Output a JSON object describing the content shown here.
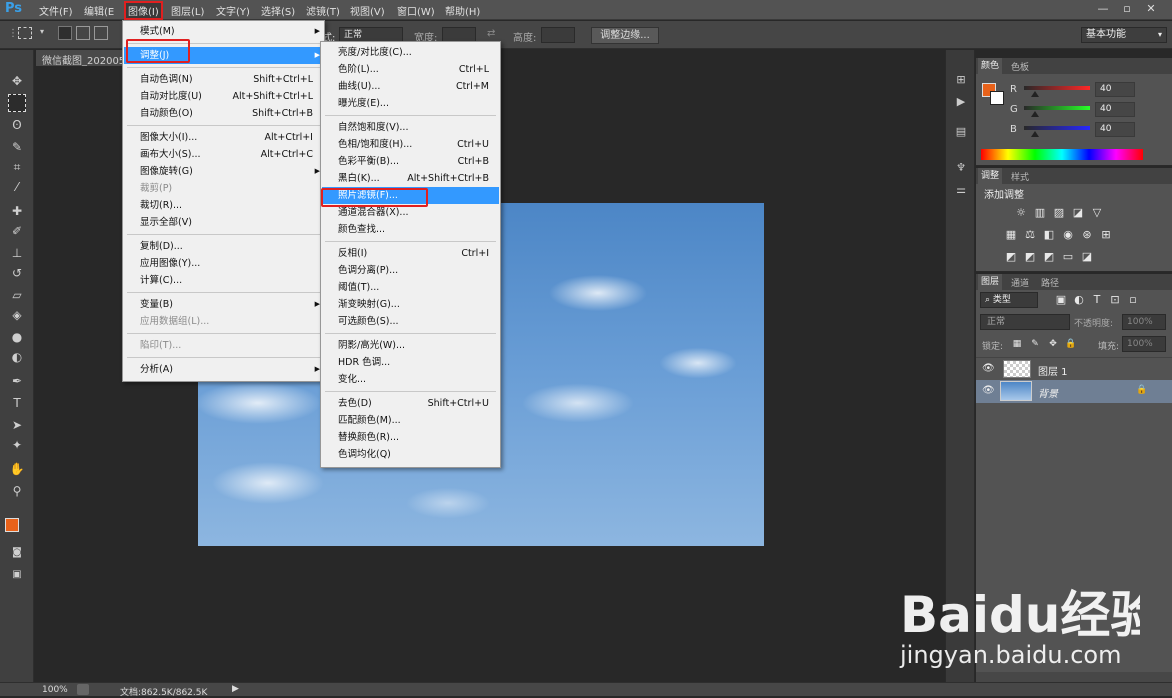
{
  "app": {
    "logo": "Ps"
  },
  "menubar": {
    "items": [
      {
        "label": "文件(F)"
      },
      {
        "label": "编辑(E"
      },
      {
        "label": "图像(I)"
      },
      {
        "label": "图层(L)"
      },
      {
        "label": "文字(Y)"
      },
      {
        "label": "选择(S)"
      },
      {
        "label": "滤镜(T)"
      },
      {
        "label": "视图(V)"
      },
      {
        "label": "窗口(W)"
      },
      {
        "label": "帮助(H)"
      }
    ],
    "win_controls": [
      "—",
      "▫",
      "✕"
    ]
  },
  "options": {
    "style_label_suffix": "式:",
    "style_value": "正常",
    "width_label": "宽度:",
    "height_label": "高度:",
    "refine_edge_button": "调整边缘...",
    "workspace": "基本功能"
  },
  "document": {
    "tab_title": "微信截图_202005"
  },
  "status": {
    "zoom": "100%",
    "doc_info": "文档:862.5K/862.5K"
  },
  "image_menu": [
    {
      "label": "模式(M)",
      "shortcut": "",
      "submenu": true
    },
    {
      "sep": true
    },
    {
      "label": "调整(J)",
      "shortcut": "",
      "submenu": true,
      "highlight": true
    },
    {
      "sep": true
    },
    {
      "label": "自动色调(N)",
      "shortcut": "Shift+Ctrl+L"
    },
    {
      "label": "自动对比度(U)",
      "shortcut": "Alt+Shift+Ctrl+L"
    },
    {
      "label": "自动颜色(O)",
      "shortcut": "Shift+Ctrl+B"
    },
    {
      "sep": true
    },
    {
      "label": "图像大小(I)...",
      "shortcut": "Alt+Ctrl+I"
    },
    {
      "label": "画布大小(S)...",
      "shortcut": "Alt+Ctrl+C"
    },
    {
      "label": "图像旋转(G)",
      "shortcut": "",
      "submenu": true
    },
    {
      "label": "裁剪(P)",
      "shortcut": "",
      "disabled": true
    },
    {
      "label": "裁切(R)...",
      "shortcut": ""
    },
    {
      "label": "显示全部(V)",
      "shortcut": ""
    },
    {
      "sep": true
    },
    {
      "label": "复制(D)...",
      "shortcut": ""
    },
    {
      "label": "应用图像(Y)...",
      "shortcut": ""
    },
    {
      "label": "计算(C)...",
      "shortcut": ""
    },
    {
      "sep": true
    },
    {
      "label": "变量(B)",
      "shortcut": "",
      "submenu": true
    },
    {
      "label": "应用数据组(L)...",
      "shortcut": "",
      "disabled": true
    },
    {
      "sep": true
    },
    {
      "label": "陷印(T)...",
      "shortcut": "",
      "disabled": true
    },
    {
      "sep": true
    },
    {
      "label": "分析(A)",
      "shortcut": "",
      "submenu": true
    }
  ],
  "adjust_menu": [
    {
      "label": "亮度/对比度(C)...",
      "shortcut": ""
    },
    {
      "label": "色阶(L)...",
      "shortcut": "Ctrl+L"
    },
    {
      "label": "曲线(U)...",
      "shortcut": "Ctrl+M"
    },
    {
      "label": "曝光度(E)...",
      "shortcut": ""
    },
    {
      "sep": true
    },
    {
      "label": "自然饱和度(V)...",
      "shortcut": ""
    },
    {
      "label": "色相/饱和度(H)...",
      "shortcut": "Ctrl+U"
    },
    {
      "label": "色彩平衡(B)...",
      "shortcut": "Ctrl+B"
    },
    {
      "label": "黑白(K)...",
      "shortcut": "Alt+Shift+Ctrl+B"
    },
    {
      "label": "照片滤镜(F)...",
      "shortcut": "",
      "highlight": true
    },
    {
      "label": "通道混合器(X)...",
      "shortcut": ""
    },
    {
      "label": "颜色查找...",
      "shortcut": ""
    },
    {
      "sep": true
    },
    {
      "label": "反相(I)",
      "shortcut": "Ctrl+I"
    },
    {
      "label": "色调分离(P)...",
      "shortcut": ""
    },
    {
      "label": "阈值(T)...",
      "shortcut": ""
    },
    {
      "label": "渐变映射(G)...",
      "shortcut": ""
    },
    {
      "label": "可选颜色(S)...",
      "shortcut": ""
    },
    {
      "sep": true
    },
    {
      "label": "阴影/高光(W)...",
      "shortcut": ""
    },
    {
      "label": "HDR 色调...",
      "shortcut": ""
    },
    {
      "label": "变化...",
      "shortcut": ""
    },
    {
      "sep": true
    },
    {
      "label": "去色(D)",
      "shortcut": "Shift+Ctrl+U"
    },
    {
      "label": "匹配颜色(M)...",
      "shortcut": ""
    },
    {
      "label": "替换颜色(R)...",
      "shortcut": ""
    },
    {
      "label": "色调均化(Q)",
      "shortcut": ""
    }
  ],
  "color_panel": {
    "tabs": [
      "颜色",
      "色板"
    ],
    "r_label": "R",
    "g_label": "G",
    "b_label": "B",
    "r": "40",
    "g": "40",
    "b": "40",
    "fg_color": "#e8621a"
  },
  "adjust_panel": {
    "tabs": [
      "调整",
      "样式"
    ],
    "title": "添加调整"
  },
  "layers_panel": {
    "tabs": [
      "图层",
      "通道",
      "路径"
    ],
    "filter": "类型",
    "blend_mode": "正常",
    "opacity_label": "不透明度:",
    "opacity": "100%",
    "lock_label": "锁定:",
    "fill_label": "填充:",
    "fill": "100%",
    "layers": [
      {
        "name": "图层 1",
        "selected": false
      },
      {
        "name": "背景",
        "selected": true
      }
    ]
  },
  "watermark": {
    "brand": "Baidu经验",
    "url": "jingyan.baidu.com"
  }
}
